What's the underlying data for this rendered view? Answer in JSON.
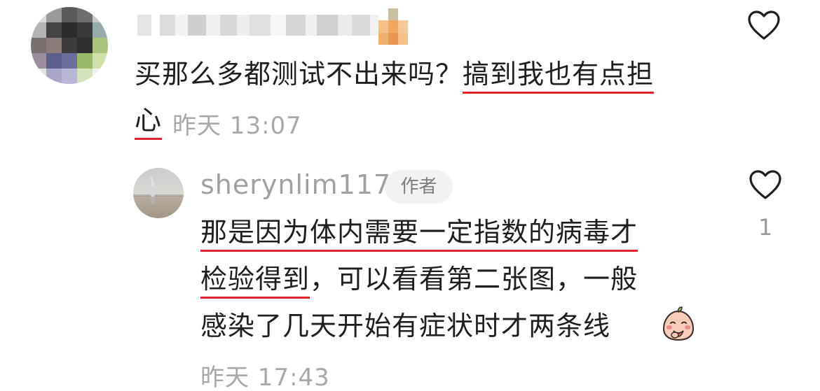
{
  "comment": {
    "text_plain": "买那么多都测试不出来吗？",
    "text_underlined_line1": "搞到我也有点担",
    "text_underlined_line2": "心",
    "timestamp": "昨天 13:07",
    "avatar_icon": "pixelated-avatar"
  },
  "reply": {
    "username": "sherynlim117",
    "author_badge": "作者",
    "line1_underlined": "那是因为体内需要一定指数的病毒才",
    "line2_underlined": "检验得到",
    "line2_rest": "，可以看看第二张图，一般",
    "line3": "感染了几天开始有症状时才两条线",
    "emoji_icon": "blushing-peach-emoji",
    "timestamp": "昨天 17:43",
    "like_count": "1"
  },
  "colors": {
    "underline": "#e0242f",
    "text": "#1f1f1f",
    "meta": "#a8a8a8"
  }
}
